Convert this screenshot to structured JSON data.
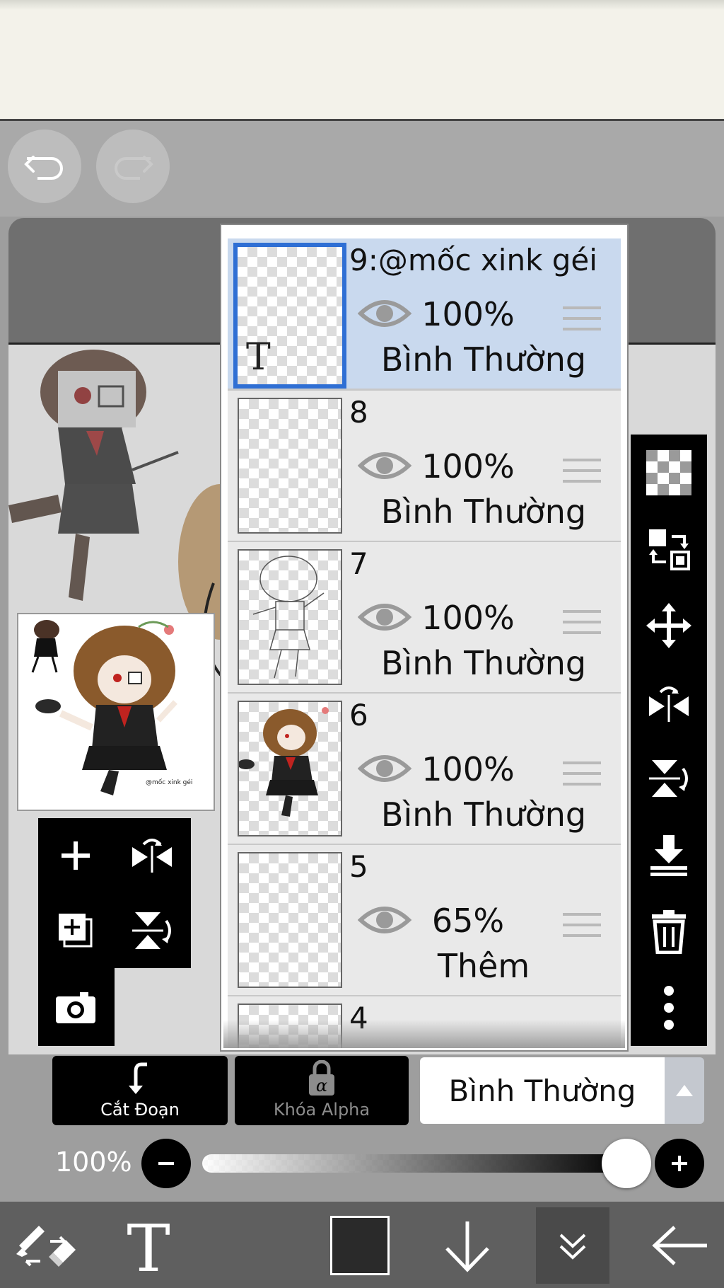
{
  "layers": [
    {
      "name": "9:@mốc xink géi",
      "opacity": "100%",
      "blend": "Bình Thường",
      "selected": true,
      "thumb_text": "T"
    },
    {
      "name": "8",
      "opacity": "100%",
      "blend": "Bình Thường",
      "selected": false
    },
    {
      "name": "7",
      "opacity": "100%",
      "blend": "Bình Thường",
      "selected": false
    },
    {
      "name": "6",
      "opacity": "100%",
      "blend": "Bình Thường",
      "selected": false
    },
    {
      "name": "5",
      "opacity": "65%",
      "blend": "Thêm",
      "selected": false
    },
    {
      "name": "4",
      "opacity": "",
      "blend": "",
      "selected": false
    }
  ],
  "actions": {
    "clipping_label": "Cắt Đoạn",
    "alpha_lock_label": "Khóa Alpha",
    "blend_mode_value": "Bình Thường"
  },
  "opacity_control": {
    "label": "100%",
    "value": 1.0
  },
  "colors": {
    "selection_blue": "#2f6fd4",
    "selected_row": "#c9d9ee",
    "toolbar_black": "#000000",
    "foreground_color": "#2a2a2a"
  }
}
